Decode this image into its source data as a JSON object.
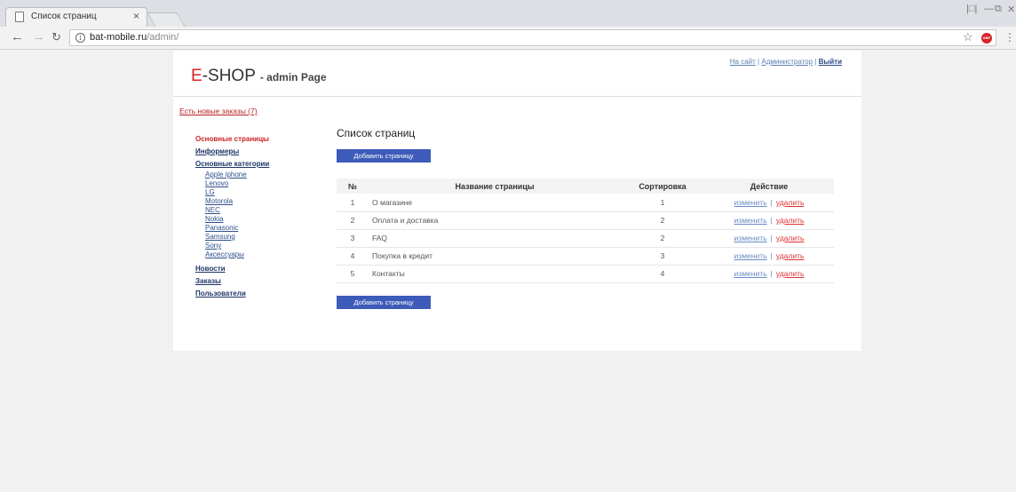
{
  "browser": {
    "tab_title": "Список страниц",
    "tab_close": "×",
    "url_host": "bat-mobile.ru",
    "url_path": "/admin/",
    "abp_label": "ABP"
  },
  "header": {
    "logo_letter": "E",
    "logo_rest": "-SHOP",
    "logo_sub": "- admin Page",
    "link_site": "На сайт",
    "link_admin": "Администратор",
    "link_logout": "Выйти",
    "separator": "|"
  },
  "orders_notice": "Есть новые заказы (7)",
  "sidebar": {
    "main_pages": "Основные страницы",
    "informers": "Информеры",
    "categories": "Основные категории",
    "category_items": [
      "Apple iphone",
      "Lenovo",
      "LG",
      "Motorola",
      "NEC",
      "Nokia",
      "Panasonic",
      "Samsung",
      "Sony",
      "Аксессуары"
    ],
    "news": "Новости",
    "orders": "Заказы",
    "users": "Пользователи"
  },
  "content": {
    "title": "Список страниц",
    "add_button": "Добавить страницу",
    "columns": [
      "№",
      "Название страницы",
      "Сортировка",
      "Действие"
    ],
    "rows": [
      {
        "num": "1",
        "name": "О магазине",
        "sort": "1"
      },
      {
        "num": "2",
        "name": "Оплата и доставка",
        "sort": "2"
      },
      {
        "num": "3",
        "name": "FAQ",
        "sort": "2"
      },
      {
        "num": "4",
        "name": "Покупка в кредит",
        "sort": "3"
      },
      {
        "num": "5",
        "name": "Контакты",
        "sort": "4"
      }
    ],
    "edit_label": "изменить",
    "delete_label": "удалить",
    "action_separator": "|"
  },
  "colors": {
    "accent_red": "#dd2222",
    "button_blue": "#3d5bb8",
    "link_blue": "#2f4f8a"
  }
}
